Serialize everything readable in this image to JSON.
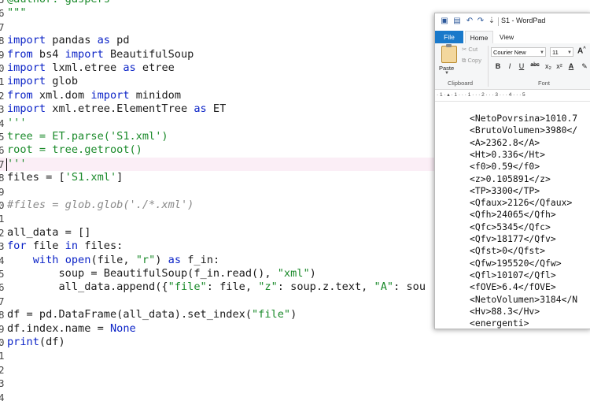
{
  "editor": {
    "lines": [
      {
        "num": "5",
        "segments": [
          {
            "t": "@author: gaspers",
            "c": "str"
          }
        ]
      },
      {
        "num": "6",
        "segments": [
          {
            "t": "\"\"\"",
            "c": "str"
          }
        ]
      },
      {
        "num": "7",
        "segments": []
      },
      {
        "num": "8",
        "segments": [
          {
            "t": "import",
            "c": "kw"
          },
          {
            "t": " pandas ",
            "c": ""
          },
          {
            "t": "as",
            "c": "kw"
          },
          {
            "t": " pd",
            "c": ""
          }
        ]
      },
      {
        "num": "9",
        "segments": [
          {
            "t": "from",
            "c": "kw"
          },
          {
            "t": " bs4 ",
            "c": ""
          },
          {
            "t": "import",
            "c": "kw"
          },
          {
            "t": " BeautifulSoup",
            "c": ""
          }
        ]
      },
      {
        "num": "0",
        "segments": [
          {
            "t": "import",
            "c": "kw"
          },
          {
            "t": " lxml.etree ",
            "c": ""
          },
          {
            "t": "as",
            "c": "kw"
          },
          {
            "t": " etree",
            "c": ""
          }
        ]
      },
      {
        "num": "1",
        "segments": [
          {
            "t": "import",
            "c": "kw"
          },
          {
            "t": " glob",
            "c": ""
          }
        ]
      },
      {
        "num": "2",
        "segments": [
          {
            "t": "from",
            "c": "kw"
          },
          {
            "t": " xml.dom ",
            "c": ""
          },
          {
            "t": "import",
            "c": "kw"
          },
          {
            "t": " minidom",
            "c": ""
          }
        ]
      },
      {
        "num": "3",
        "segments": [
          {
            "t": "import",
            "c": "kw"
          },
          {
            "t": " xml.etree.ElementTree ",
            "c": ""
          },
          {
            "t": "as",
            "c": "kw"
          },
          {
            "t": " ET",
            "c": ""
          }
        ]
      },
      {
        "num": "4",
        "segments": [
          {
            "t": "'''",
            "c": "str"
          }
        ]
      },
      {
        "num": "5",
        "segments": [
          {
            "t": "tree = ET.parse('S1.xml')",
            "c": "str"
          }
        ]
      },
      {
        "num": "6",
        "segments": [
          {
            "t": "root = tree.getroot()",
            "c": "str"
          }
        ]
      },
      {
        "num": "7",
        "segments": [
          {
            "t": "'''",
            "c": "str"
          }
        ],
        "current": true
      },
      {
        "num": "8",
        "segments": [
          {
            "t": "files = [",
            "c": ""
          },
          {
            "t": "'S1.xml'",
            "c": "str"
          },
          {
            "t": "]",
            "c": ""
          }
        ]
      },
      {
        "num": "9",
        "segments": []
      },
      {
        "num": "0",
        "segments": [
          {
            "t": "#files = glob.glob('./*.xml')",
            "c": "cmt"
          }
        ]
      },
      {
        "num": "1",
        "segments": []
      },
      {
        "num": "2",
        "segments": [
          {
            "t": "all_data = []",
            "c": ""
          }
        ]
      },
      {
        "num": "3",
        "segments": [
          {
            "t": "for",
            "c": "kw"
          },
          {
            "t": " file ",
            "c": ""
          },
          {
            "t": "in",
            "c": "kw"
          },
          {
            "t": " files:",
            "c": ""
          }
        ]
      },
      {
        "num": "4",
        "segments": [
          {
            "t": "    ",
            "c": ""
          },
          {
            "t": "with",
            "c": "kw"
          },
          {
            "t": " ",
            "c": ""
          },
          {
            "t": "open",
            "c": "kw"
          },
          {
            "t": "(file, ",
            "c": ""
          },
          {
            "t": "\"r\"",
            "c": "str"
          },
          {
            "t": ") ",
            "c": ""
          },
          {
            "t": "as",
            "c": "kw"
          },
          {
            "t": " f_in:",
            "c": ""
          }
        ]
      },
      {
        "num": "5",
        "segments": [
          {
            "t": "        soup = BeautifulSoup(f_in.read(), ",
            "c": ""
          },
          {
            "t": "\"xml\"",
            "c": "str"
          },
          {
            "t": ")",
            "c": ""
          }
        ]
      },
      {
        "num": "6",
        "segments": [
          {
            "t": "        all_data.append({",
            "c": ""
          },
          {
            "t": "\"file\"",
            "c": "str"
          },
          {
            "t": ": file, ",
            "c": ""
          },
          {
            "t": "\"z\"",
            "c": "str"
          },
          {
            "t": ": soup.z.text, ",
            "c": ""
          },
          {
            "t": "\"A\"",
            "c": "str"
          },
          {
            "t": ": sou",
            "c": ""
          }
        ]
      },
      {
        "num": "7",
        "segments": []
      },
      {
        "num": "8",
        "segments": [
          {
            "t": "df = pd.DataFrame(all_data).set_index(",
            "c": ""
          },
          {
            "t": "\"file\"",
            "c": "str"
          },
          {
            "t": ")",
            "c": ""
          }
        ]
      },
      {
        "num": "9",
        "segments": [
          {
            "t": "df.index.name = ",
            "c": ""
          },
          {
            "t": "None",
            "c": "kw"
          }
        ]
      },
      {
        "num": "0",
        "segments": [
          {
            "t": "print",
            "c": "kw"
          },
          {
            "t": "(df)",
            "c": ""
          }
        ]
      },
      {
        "num": "1",
        "segments": []
      },
      {
        "num": "2",
        "segments": []
      },
      {
        "num": "3",
        "segments": []
      },
      {
        "num": "4",
        "segments": []
      }
    ]
  },
  "wordpad": {
    "title": "S1 - WordPad",
    "tabs": {
      "file": "File",
      "home": "Home",
      "view": "View"
    },
    "clipboard": {
      "paste": "Paste",
      "cut": "Cut",
      "copy": "Copy",
      "group_label": "Clipboard"
    },
    "font": {
      "family": "Courier New",
      "size": "11",
      "group_label": "Font",
      "buttons": [
        "B",
        "I",
        "U",
        "abc",
        "x₂",
        "x²",
        "A"
      ]
    },
    "ruler": "· 1 · ▴ · 1 · · · 1 · · · 2 · · · 3 · · · 4 · · · 5",
    "document_lines": [
      "<NetoPovrsina>1010.7",
      "<BrutoVolumen>3980</",
      "<A>2362.8</A>",
      "<Ht>0.336</Ht>",
      "<f0>0.59</f0>",
      "<z>0.105891</z>",
      "<TP>3300</TP>",
      "<Qfaux>2126</Qfaux>",
      "<Qfh>24065</Qfh>",
      "<Qfc>5345</Qfc>",
      "<Qfv>18177</Qfv>",
      "<Qfst>0</Qfst>",
      "<Qfw>195520</Qfw>",
      "<Qfl>10107</Qfl>",
      "<fOVE>6.4</fOVE>",
      "<NetoVolumen>3184</N",
      "<Hv>88.3</Hv>",
      "<energenti>"
    ]
  }
}
